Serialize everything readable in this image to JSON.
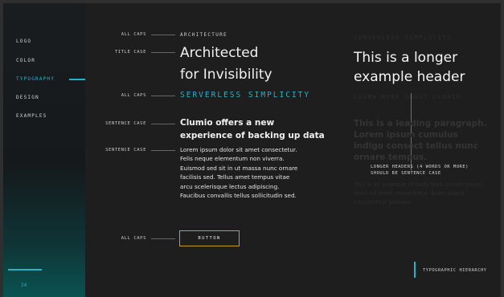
{
  "sidebar": {
    "items": [
      {
        "label": "LOGO"
      },
      {
        "label": "COLOR"
      },
      {
        "label": "TYPOGRAPHY"
      },
      {
        "label": "DESIGN"
      },
      {
        "label": "EXAMPLES"
      }
    ],
    "active_index": 2,
    "page_number": "24"
  },
  "specimens": {
    "caps_label_1": "ALL CAPS",
    "caps_text_1": "ARCHITECTURE",
    "title_label": "TITLE CASE",
    "title_text_line1": "Architected",
    "title_text_line2": "for Invisibility",
    "caps_label_2": "ALL CAPS",
    "teal_text": "SERVERLESS SIMPLICITY",
    "sentence_label_1": "SENTENCE CASE",
    "sentence_text_line1": "Clumio offers a new",
    "sentence_text_line2": "experience of backing up data",
    "sentence_label_2": "SENTENCE CASE",
    "body_lines": [
      "Lorem ipsum dolor sit amet consectetur.",
      "Felis neque elementum non viverra.",
      "Euismod sed sit in ut massa nunc ornare",
      "facilisis sed. Tellus amet tempus vitae",
      "arcu scelerisque lectus adipiscing.",
      "Faucibus convallis tellus sollicitudin sed."
    ],
    "caps_label_3": "ALL CAPS",
    "button_label": "BUTTON"
  },
  "example": {
    "ghost_caps": "SERVERLESS SIMPLICITY",
    "header_line1": "This is a longer",
    "header_line2": "example header",
    "ghost_caps_2": "LEARN MORE ABOUT CLUMIO",
    "ghost_para": "This is a leading paragraph. Lorem ipsum cumulus indigo consect tellus nunc ornare tempus.",
    "ghost_small": "This is an example of body text. Lorem ipsum dolor sit amet consectetur. Enim aliqua consectetur posuere.",
    "note_line1": "LONGER HEADERS (4 WORDS OR MORE)",
    "note_line2": "SHOULD BE SENTENCE CASE"
  },
  "footer": {
    "hierarchy_label": "TYPOGRAPHIC HIERARCHY"
  },
  "colors": {
    "accent": "#27b2c8",
    "button_border": "#c79a2a",
    "background": "#1e1e1e"
  }
}
